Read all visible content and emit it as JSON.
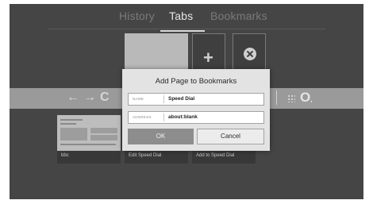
{
  "tabs": [
    {
      "label": "History",
      "active": false
    },
    {
      "label": "Tabs",
      "active": true
    },
    {
      "label": "Bookmarks",
      "active": false
    }
  ],
  "speed_dial": {
    "add_icon": "plus-icon",
    "remove_icon": "close-circle-icon",
    "thumbnails": [
      {
        "label": "bbc"
      },
      {
        "label": "Edit Speed Dial"
      },
      {
        "label": "Add to Speed Dial"
      }
    ]
  },
  "nav": {
    "back_icon": "back-arrow-icon",
    "forward_icon": "forward-arrow-icon",
    "reload_icon": "reload-icon",
    "grid_icon": "grid-icon",
    "opera_icon": "opera-logo-icon"
  },
  "dialog": {
    "title": "Add Page to Bookmarks",
    "name_label": "NAME",
    "name_value": "Speed Dial",
    "address_label": "ADDRESS",
    "address_value": "about:blank",
    "ok_label": "OK",
    "cancel_label": "Cancel"
  }
}
